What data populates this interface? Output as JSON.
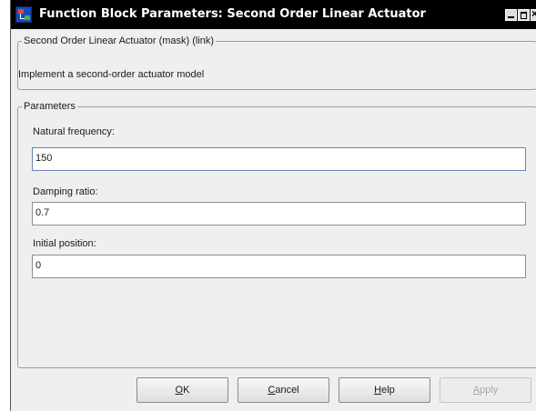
{
  "window": {
    "title": "Function Block Parameters: Second Order Linear Actuator",
    "icon": "simulink-block-icon"
  },
  "mask_group": {
    "legend": "Second Order Linear Actuator (mask) (link)",
    "description": "Implement a second-order actuator model"
  },
  "params_group": {
    "legend": "Parameters",
    "fields": [
      {
        "label": "Natural frequency:",
        "value": "150"
      },
      {
        "label": "Damping ratio:",
        "value": "0.7"
      },
      {
        "label": "Initial position:",
        "value": "0"
      }
    ]
  },
  "buttons": {
    "ok": {
      "mnemonic": "O",
      "rest": "K"
    },
    "cancel": {
      "mnemonic": "C",
      "rest": "ancel"
    },
    "help": {
      "mnemonic": "H",
      "rest": "elp"
    },
    "apply": {
      "mnemonic": "A",
      "rest": "pply"
    }
  }
}
